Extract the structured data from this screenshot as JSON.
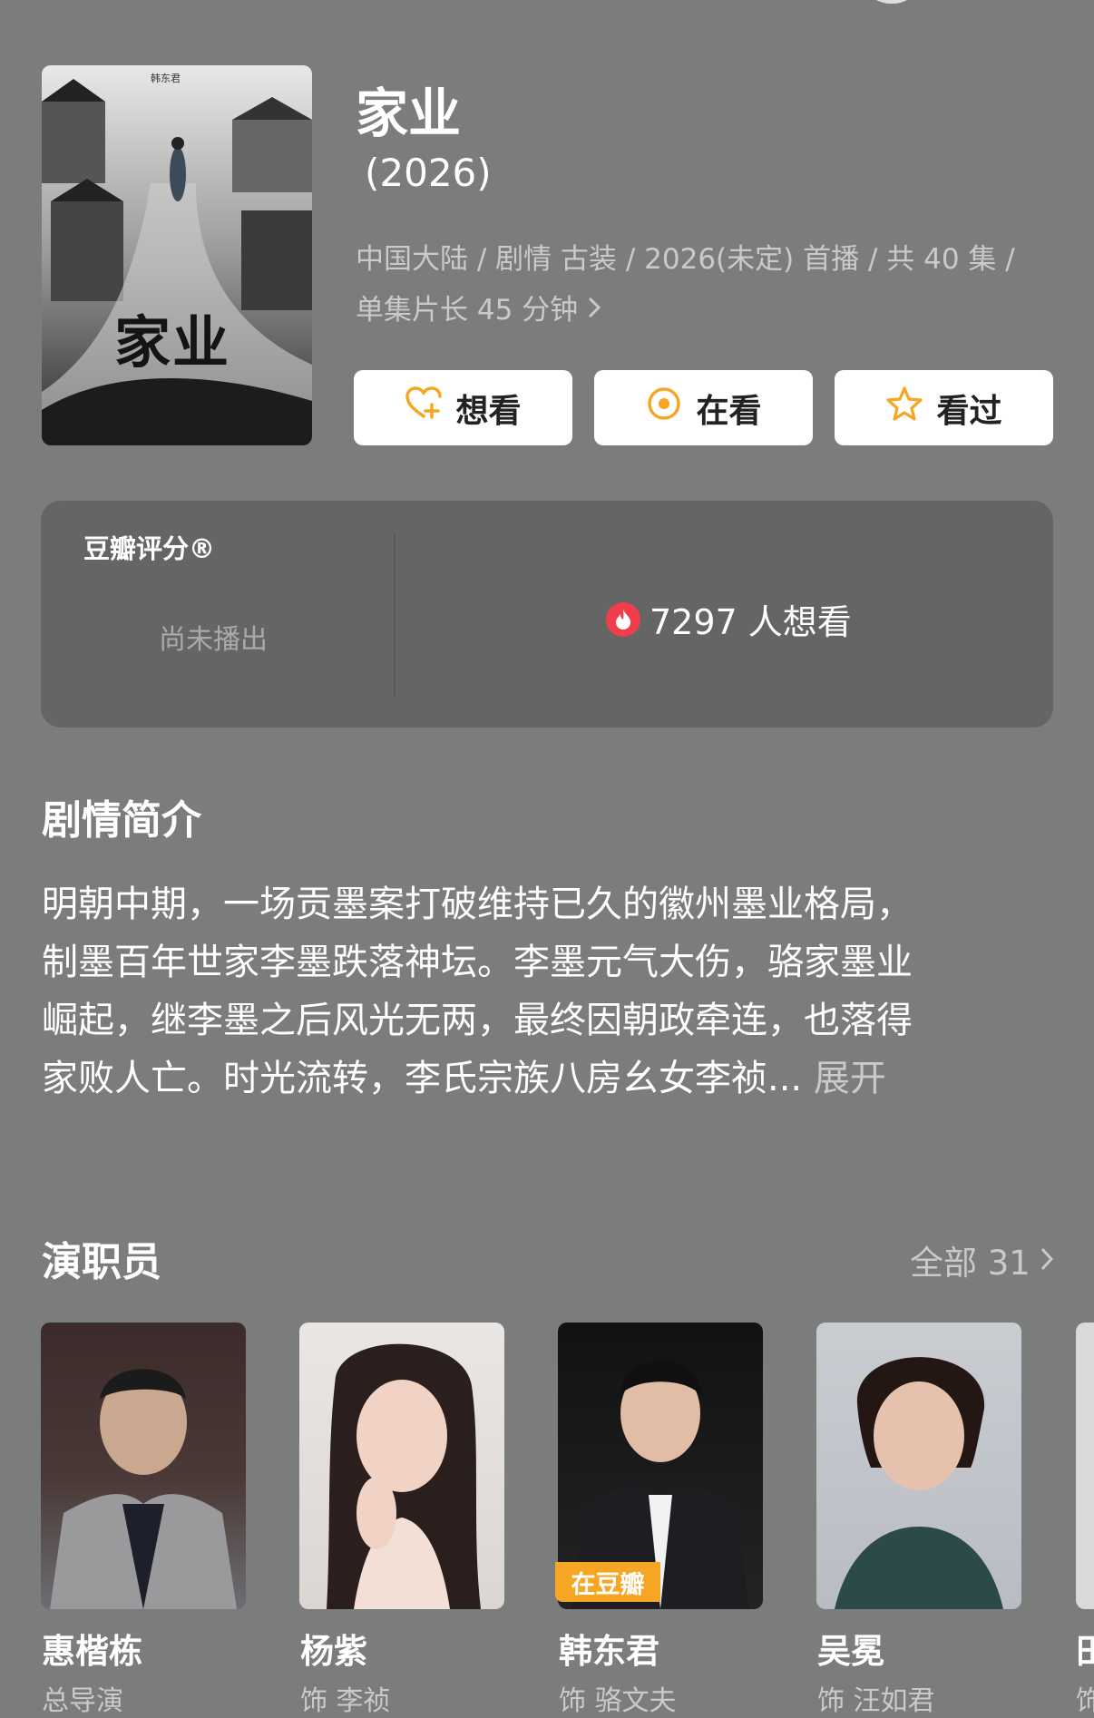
{
  "show": {
    "title": "家业",
    "year": "(2026)",
    "meta_line1": "中国大陆 / 剧情 古装 / 2026(未定) 首播 / 共 40 集 /",
    "meta_line2": "单集片长 45 分钟",
    "poster_title": "家业",
    "poster_credit": "韩东君"
  },
  "actions": {
    "want": "想看",
    "watching": "在看",
    "watched": "看过"
  },
  "rating": {
    "label": "豆瓣评分®",
    "status": "尚未播出",
    "want_count": "7297 人想看"
  },
  "plot": {
    "title": "剧情简介",
    "lines": [
      "明朝中期，一场贡墨案打破维持已久的徽州墨业格局，",
      "制墨百年世家李墨跌落神坛。李墨元气大伤，骆家墨业",
      "崛起，继李墨之后风光无两，最终因朝政牵连，也落得",
      "家败人亡。时光流转，李氏宗族八房幺女李祯..."
    ],
    "expand": "展开"
  },
  "cast": {
    "title": "演职员",
    "all_label": "全部 31",
    "badge": "在豆瓣",
    "people": [
      {
        "name": "惠楷栋",
        "role": "总导演"
      },
      {
        "name": "杨紫",
        "role": "饰 李祯"
      },
      {
        "name": "韩东君",
        "role": "饰 骆文夫"
      },
      {
        "name": "吴冕",
        "role": "饰 汪如君"
      },
      {
        "name": "田",
        "role": "饰"
      }
    ]
  },
  "colors": {
    "background": "#7b7d7c",
    "card": "#656566",
    "accent_orange": "#f5a623",
    "fire_red": "#ef3e4a"
  }
}
